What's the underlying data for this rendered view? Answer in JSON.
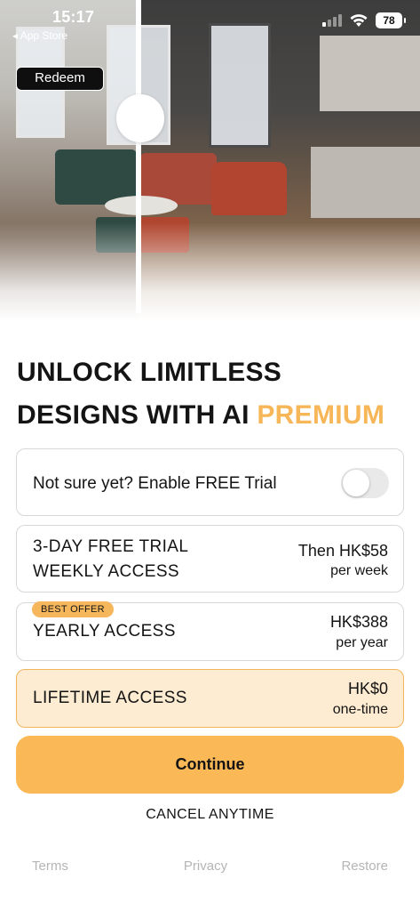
{
  "status_bar": {
    "time": "15:17",
    "back_label": "◂ App Store",
    "battery": "78"
  },
  "hero": {
    "redeem_label": "Redeem",
    "description": ""
  },
  "title": {
    "line1": "UNLOCK LIMITLESS",
    "line2_prefix": "DESIGNS WITH AI ",
    "line2_accent": "PREMIUM"
  },
  "trial_toggle": {
    "label": "Not sure yet? Enable FREE Trial",
    "enabled": false
  },
  "plans": [
    {
      "name_line1": "3-DAY FREE TRIAL",
      "name_line2": "WEEKLY ACCESS",
      "price": "Then HK$58",
      "period": "per week",
      "badge": "",
      "selected": false
    },
    {
      "name_line1": "YEARLY ACCESS",
      "price": "HK$388",
      "period": "per year",
      "badge": "BEST OFFER",
      "selected": false
    },
    {
      "name_line1": "LIFETIME ACCESS",
      "price": "HK$0",
      "period": "one-time",
      "badge": "",
      "selected": true
    }
  ],
  "actions": {
    "continue_label": "Continue",
    "cancel_label": "CANCEL ANYTIME"
  },
  "footer": {
    "terms": "Terms",
    "privacy": "Privacy",
    "restore": "Restore"
  },
  "colors": {
    "accent": "#f7b658",
    "continue_bg": "#fbb857",
    "selected_bg": "#fdebd2"
  }
}
